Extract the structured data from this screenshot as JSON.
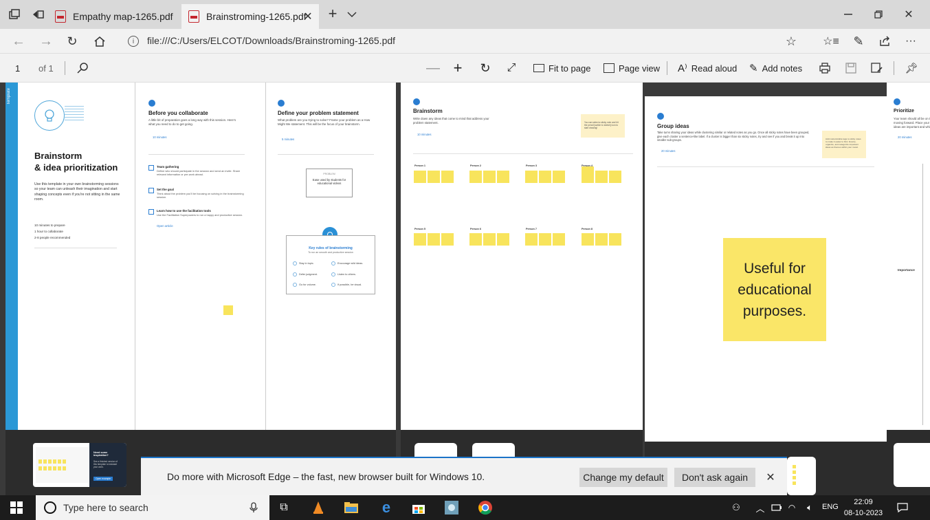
{
  "browser": {
    "tabs": [
      {
        "label": "Empathy map-1265.pdf",
        "active": false
      },
      {
        "label": "Brainstroming-1265.pdf",
        "active": true
      }
    ],
    "address": "file:///C:/Users/ELCOT/Downloads/Brainstroming-1265.pdf"
  },
  "pdf_toolbar": {
    "page_number": "1",
    "page_total": "of 1",
    "fit_to_page": "Fit to page",
    "page_view": "Page view",
    "read_aloud": "Read aloud",
    "add_notes": "Add notes"
  },
  "document": {
    "side_tab": "Template",
    "cover": {
      "title_line1": "Brainstorm",
      "title_line2": "& idea prioritization",
      "description": "Use this template in your own brainstorming sessions so your team can unleash their imagination and start shaping concepts even if you're not sitting in the same room.",
      "meta": [
        "10 minutes to prepare",
        "1 hour to collaborate",
        "2-8 people recommended"
      ]
    },
    "step1": {
      "title": "Before you collaborate",
      "text": "A little bit of preparation goes a long way with this session. Here's what you need to do to get going.",
      "time": "10 minutes",
      "items": [
        {
          "title": "Team gathering",
          "text": "Define who should participate in the session and send an invite. Share relevant information or pre-work ahead."
        },
        {
          "title": "Set the goal",
          "text": "Think about the problem you'll be focusing on solving in the brainstorming session."
        },
        {
          "title": "Learn how to use the facilitation tools",
          "text": "Use the Facilitation Superpowers to run a happy and productive session."
        }
      ],
      "link": "Open article"
    },
    "step2": {
      "title": "Define your problem statement",
      "text": "What problem are you trying to solve? Frame your problem as a How Might We statement. This will be the focus of your brainstorm.",
      "time": "5 minutes",
      "problem_box_label": "PROBLEM",
      "problem_box_text": "Ease used by students for educational videos",
      "key_rules_title": "Key rules of brainstorming",
      "key_rules_sub": "To run an smooth and productive session",
      "rules": [
        "Stay in topic.",
        "Encourage wild ideas.",
        "Defer judgment.",
        "Listen to others.",
        "Go for volume.",
        "If possible, be visual."
      ]
    },
    "step3": {
      "title": "Brainstorm",
      "text": "Write down any ideas that come to mind that address your problem statement.",
      "time": "10 minutes",
      "tip": "You can select a sticky note and hit the pencil [switch to sketch] icon to start drawing!",
      "persons": [
        "Person 1",
        "Person 2",
        "Person 3",
        "Person 4",
        "Person 5",
        "Person 6",
        "Person 7",
        "Person 8"
      ]
    },
    "step4": {
      "title": "Group ideas",
      "text": "Take turns sharing your ideas while clustering similar or related notes as you go. Once all sticky notes have been grouped, give each cluster a sentence-like label. If a cluster is bigger than six sticky notes, try and see if you and break it up into smaller sub-groups.",
      "time": "20 minutes",
      "tip": "Add customizable tags to sticky notes to make it easier to find, browse, organize, and categorize important ideas as themes within your mural.",
      "sticky_note": "Useful for educational purposes."
    },
    "step5": {
      "title": "Prioritize",
      "text": "Your team should all be on the same page about what's important moving forward. Place your ideas on this grid to determine which ideas are important and which are feasible.",
      "time": "20 minutes",
      "axis_label": "Importance"
    },
    "thumb": {
      "title": "Need some inspiration?",
      "text": "See a finished version of this template to kickstart your work.",
      "button": "Open example"
    }
  },
  "notification": {
    "message": "Do more with Microsoft Edge – the fast, new browser built for Windows 10.",
    "change_default": "Change my default",
    "dont_ask": "Don't ask again"
  },
  "taskbar": {
    "search_placeholder": "Type here to search",
    "language": "ENG",
    "time": "22:09",
    "date": "08-10-2023"
  },
  "colors": {
    "accent": "#1a73c8",
    "sticky": "#f8e45c",
    "sidebar_blue": "#2b98d6"
  }
}
